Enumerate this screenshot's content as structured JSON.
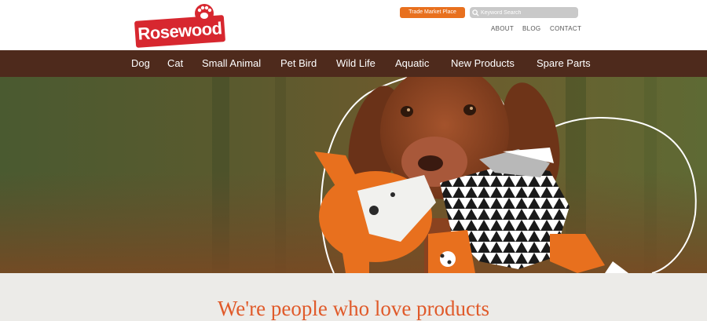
{
  "brand": {
    "name": "Rosewood",
    "logo_color": "#d7272f"
  },
  "header": {
    "trade_button_label": "Trade Market Place",
    "search_placeholder": "Keyword Search",
    "top_links": [
      "ABOUT",
      "BLOG",
      "CONTACT"
    ]
  },
  "nav": {
    "items": [
      "Dog",
      "Cat",
      "Small Animal",
      "Pet Bird",
      "Wild Life",
      "Aquatic",
      "New Products",
      "Spare Parts"
    ],
    "background": "#4e2a1c"
  },
  "hero": {
    "icons": [
      "dog-photo",
      "fox-toy",
      "hedgehog-toy",
      "heart-outline"
    ],
    "accent_color": "#e8701e"
  },
  "tagline": {
    "text": "We're people who love products",
    "color": "#e05a2a"
  }
}
